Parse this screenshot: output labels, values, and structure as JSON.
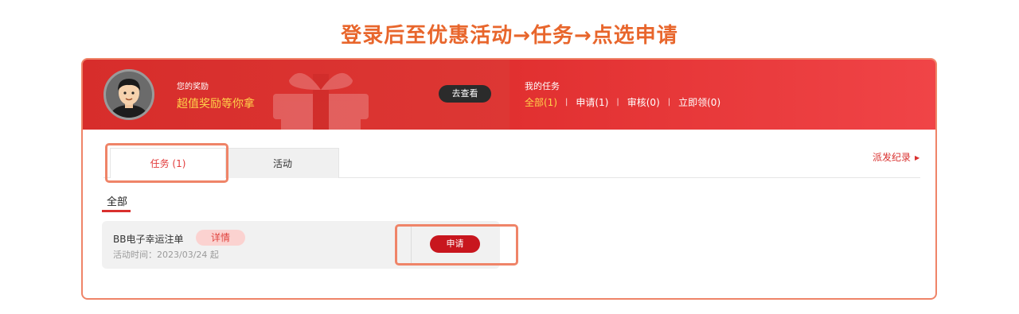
{
  "headline": "登录后至优惠活动→任务→点选申请",
  "banner": {
    "reward_small": "您的奖励",
    "reward_big": "超值奖励等你拿",
    "view_button": "去查看",
    "my_tasks_title": "我的任务",
    "filters": [
      {
        "label": "全部(1)",
        "active": true
      },
      {
        "label": "申请(1)",
        "active": false
      },
      {
        "label": "审核(0)",
        "active": false
      },
      {
        "label": "立即领(0)",
        "active": false
      }
    ],
    "separator": "|"
  },
  "tabs": [
    {
      "label": "任务 (1)",
      "active": true
    },
    {
      "label": "活动",
      "active": false
    }
  ],
  "records_link": "派发纪录",
  "filter_all": "全部",
  "task_card": {
    "title": "BB电子幸运注单",
    "detail_badge": "详情",
    "time": "活动时间：2023/03/24 起",
    "apply_button": "申请"
  },
  "colors": {
    "accent": "#d9302e",
    "highlight": "#ef8468",
    "gold": "#ffd24a",
    "headline": "#e8662c"
  },
  "icons": [
    "avatar",
    "gift-icon",
    "caret-right-icon"
  ]
}
